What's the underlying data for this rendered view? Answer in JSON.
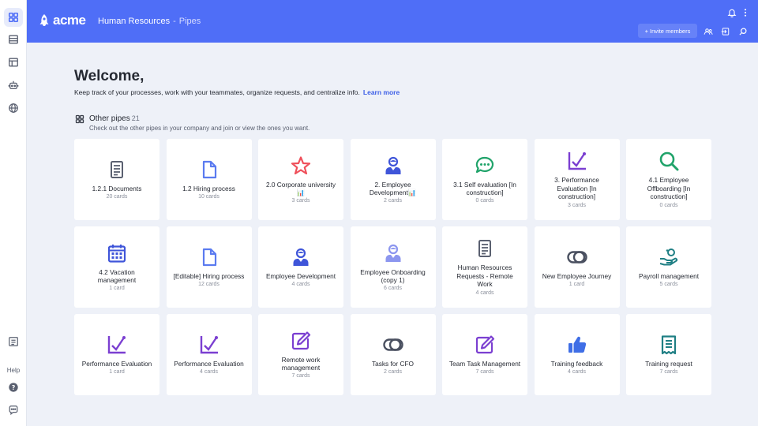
{
  "header": {
    "logo_text": "acme",
    "breadcrumb_org": "Human Resources",
    "breadcrumb_sep": "-",
    "breadcrumb_current": "Pipes",
    "invite_label": "Invite members",
    "invite_prefix": "+"
  },
  "rail": {
    "help_label": "Help"
  },
  "main": {
    "welcome": "Welcome,",
    "intro": "Keep track of your processes, work with your teammates, organize requests, and centralize info.",
    "learn_more": "Learn more",
    "section_title": "Other pipes",
    "section_count": "21",
    "section_subtitle": "Check out the other pipes in your company and join or view the ones you want."
  },
  "colors": {
    "accent": "#4f6ef7",
    "background": "#eef1f8"
  },
  "pipes": [
    {
      "name": "1.2.1 Documents",
      "count": "20 cards",
      "icon": "document-icon",
      "color": "#5a6070"
    },
    {
      "name": "1.2 Hiring process",
      "count": "10 cards",
      "icon": "file-icon",
      "color": "#5b7bf0"
    },
    {
      "name": "2.0 Corporate university 📊",
      "count": "3 cards",
      "icon": "star-icon",
      "color": "#ef4f5a"
    },
    {
      "name": "2. Employee Development📊",
      "count": "2 cards",
      "icon": "user-icon",
      "color": "#3f55d9"
    },
    {
      "name": "3.1 Self evaluation [In construction]",
      "count": "0 cards",
      "icon": "chat-icon",
      "color": "#20a36a"
    },
    {
      "name": "3. Performance Evaluation [In construction]",
      "count": "3 cards",
      "icon": "chart-line-icon",
      "color": "#7b3fd1"
    },
    {
      "name": "4.1 Employee Offboarding [In construction]",
      "count": "0 cards",
      "icon": "search-icon",
      "color": "#20a36a"
    },
    {
      "name": "4.2 Vacation management",
      "count": "1 card",
      "icon": "calendar-icon",
      "color": "#3f55d9"
    },
    {
      "name": "[Editable] Hiring process",
      "count": "12 cards",
      "icon": "file-icon",
      "color": "#5b7bf0"
    },
    {
      "name": "Employee Development",
      "count": "4 cards",
      "icon": "user-icon",
      "color": "#3f55d9"
    },
    {
      "name": "Employee Onboarding (copy 1)",
      "count": "6 cards",
      "icon": "user-icon",
      "color": "#8c96ef"
    },
    {
      "name": "Human Resources Requests - Remote Work",
      "count": "4 cards",
      "icon": "document-icon",
      "color": "#5a6070"
    },
    {
      "name": "New Employee Journey",
      "count": "1 card",
      "icon": "toggle-icon",
      "color": "#4a5060"
    },
    {
      "name": "Payroll management",
      "count": "5 cards",
      "icon": "hand-coin-icon",
      "color": "#1f7f84"
    },
    {
      "name": "Performance Evaluation",
      "count": "1 card",
      "icon": "chart-line-icon",
      "color": "#7b3fd1"
    },
    {
      "name": "Performance Evaluation",
      "count": "4 cards",
      "icon": "chart-line-icon",
      "color": "#7b3fd1"
    },
    {
      "name": "Remote work management",
      "count": "7 cards",
      "icon": "edit-icon",
      "color": "#7b3fd1"
    },
    {
      "name": "Tasks for CFO",
      "count": "2 cards",
      "icon": "toggle-icon",
      "color": "#4a5060"
    },
    {
      "name": "Team Task Management",
      "count": "7 cards",
      "icon": "edit-icon",
      "color": "#7b3fd1"
    },
    {
      "name": "Training feedback",
      "count": "4 cards",
      "icon": "thumbs-up-icon",
      "color": "#3f6ee6"
    },
    {
      "name": "Training request",
      "count": "7 cards",
      "icon": "receipt-icon",
      "color": "#1f7f84"
    }
  ]
}
